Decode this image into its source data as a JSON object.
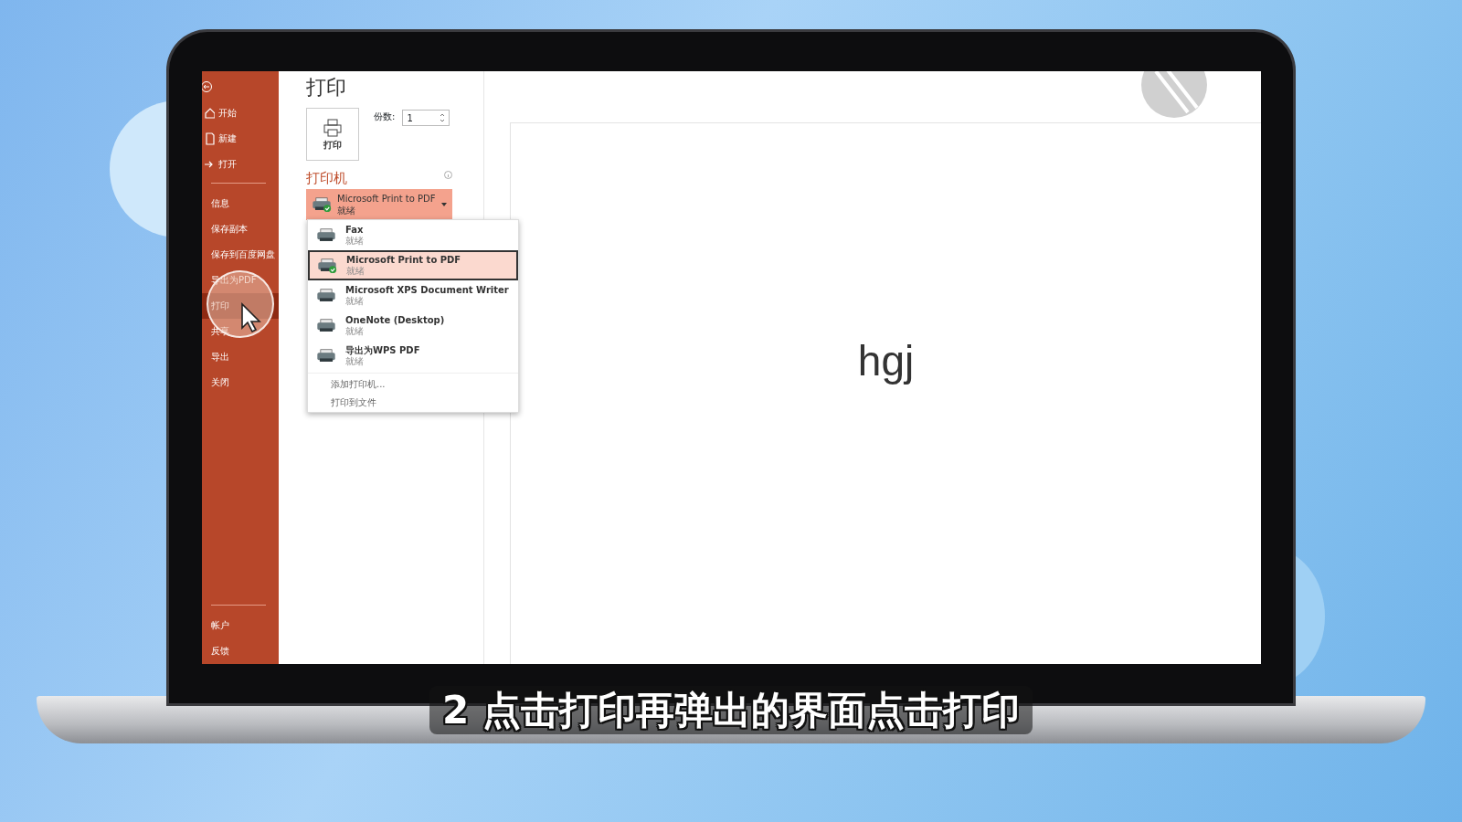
{
  "sidebar": {
    "top_items": [
      {
        "label": "开始"
      },
      {
        "label": "新建"
      },
      {
        "label": "打开"
      }
    ],
    "items": [
      {
        "label": "信息",
        "selected": false
      },
      {
        "label": "保存副本",
        "selected": false
      },
      {
        "label": "保存到百度网盘",
        "selected": false
      },
      {
        "label": "导出为PDF",
        "selected": false
      },
      {
        "label": "打印",
        "selected": true
      },
      {
        "label": "共享",
        "selected": false
      },
      {
        "label": "导出",
        "selected": false
      },
      {
        "label": "关闭",
        "selected": false
      }
    ],
    "bottom_items": [
      {
        "label": "帐户"
      },
      {
        "label": "反馈"
      }
    ]
  },
  "print_panel": {
    "title": "打印",
    "print_button": "打印",
    "copies": {
      "label": "份数:",
      "value": "1"
    },
    "printer": {
      "heading": "打印机",
      "name": "Microsoft Print to PDF",
      "status": "就绪"
    },
    "dropdown": {
      "items": [
        {
          "name": "Fax",
          "status": "就绪",
          "selected": false,
          "default": false
        },
        {
          "name": "Microsoft Print to PDF",
          "status": "就绪",
          "selected": true,
          "default": true
        },
        {
          "name": "Microsoft XPS Document Writer",
          "status": "就绪",
          "selected": false,
          "default": false
        },
        {
          "name": "OneNote (Desktop)",
          "status": "就绪",
          "selected": false,
          "default": false
        },
        {
          "name": "导出为WPS PDF",
          "status": "就绪",
          "selected": false,
          "default": false
        }
      ],
      "actions": [
        "添加打印机...",
        "打印到文件"
      ]
    }
  },
  "preview": {
    "text": "hgj"
  },
  "subtitle": "2 点击打印再弹出的界面点击打印"
}
